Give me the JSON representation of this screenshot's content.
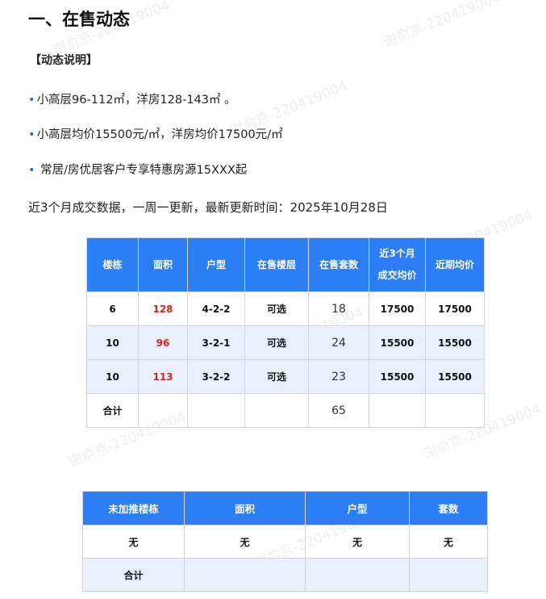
{
  "title": "一、在售动态",
  "note_heading": "【动态说明】",
  "bullets": [
    {
      "dot": "•",
      "text": "小高层96-112㎡，洋房128-143㎡ 。"
    },
    {
      "dot": "•",
      "text": "小高层均价15500元/㎡，洋房均价17500元/㎡"
    },
    {
      "dot": "•",
      "text": " 常居/房优居客户专享特惠房源15XXX起"
    }
  ],
  "intro": "近3个月成交数据，一周一更新，最新更新时间：2025年10月28日",
  "sales_table": {
    "headers": [
      "楼栋",
      "面积",
      "户型",
      "在售楼层",
      "在售套数",
      "近3个月\n成交均价",
      "近期均价"
    ],
    "rows": [
      [
        "6",
        "128",
        "4-2-2",
        "可选",
        "18",
        "17500",
        "17500"
      ],
      [
        "10",
        "96",
        "3-2-1",
        "可选",
        "24",
        "15500",
        "15500"
      ],
      [
        "10",
        "113",
        "3-2-2",
        "可选",
        "23",
        "15500",
        "15500"
      ],
      [
        "合计",
        "",
        "",
        "",
        "65",
        "",
        ""
      ]
    ]
  },
  "unlaunched_table": {
    "headers": [
      "未加推楼栋",
      "面积",
      "户型",
      "套数"
    ],
    "rows": [
      [
        "无",
        "无",
        "无",
        "无"
      ],
      [
        "合计",
        "",
        "",
        ""
      ]
    ]
  },
  "watermark": "谢俞京-220419004"
}
